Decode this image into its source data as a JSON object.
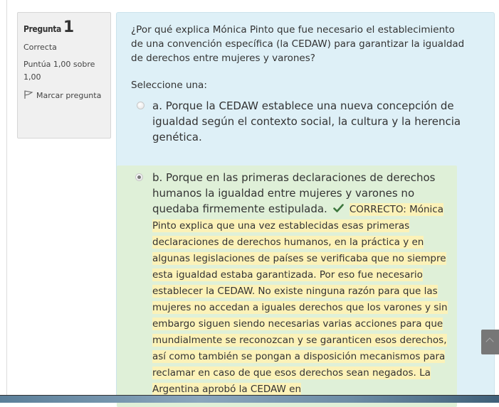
{
  "question_info": {
    "label": "Pregunta",
    "number": "1",
    "state": "Correcta",
    "grade": "Puntúa 1,00 sobre 1,00",
    "flag_label": "Marcar pregunta"
  },
  "question": {
    "text": "¿Por qué explica Mónica Pinto que fue necesario el establecimiento de una convención específica (la CEDAW) para garantizar la igualdad de derechos entre mujeres y varones?",
    "prompt": "Seleccione una:",
    "answers": [
      {
        "label": "a. Porque la CEDAW establece una nueva concepción de igualdad según el contexto social, la cultura y la herencia genética.",
        "selected": false
      },
      {
        "label": "b. Porque en las primeras declaraciones de derechos humanos la igualdad entre mujeres y varones no quedaba firmemente estipulada.",
        "selected": true,
        "feedback": "CORRECTO: Mónica Pinto explica que una vez establecidas esas primeras declaraciones de derechos humanos, en la práctica y en algunas legislaciones de países se verificaba que no siempre esta igualdad estaba garantizada. Por eso fue necesario establecer la CEDAW. No existe ninguna razón para que las mujeres no accedan a iguales derechos que los varones y  sin embargo siguen siendo necesarias varias acciones para que mundialmente se reconozcan y se garanticen esos derechos, así como también se pongan a disposición mecanismos para reclamar en caso de que esos derechos sean negados. La Argentina aprobó la CEDAW en"
      }
    ]
  },
  "icons": {
    "flag": "flag-icon",
    "correct": "check-icon",
    "scroll_top": "chevron-up-icon"
  },
  "colors": {
    "info_bg": "#f0f0f0",
    "question_bg": "#def0f7",
    "correct_bg": "#dff0d8",
    "feedback_bg": "#fcf2b8",
    "check": "#3c763d"
  }
}
